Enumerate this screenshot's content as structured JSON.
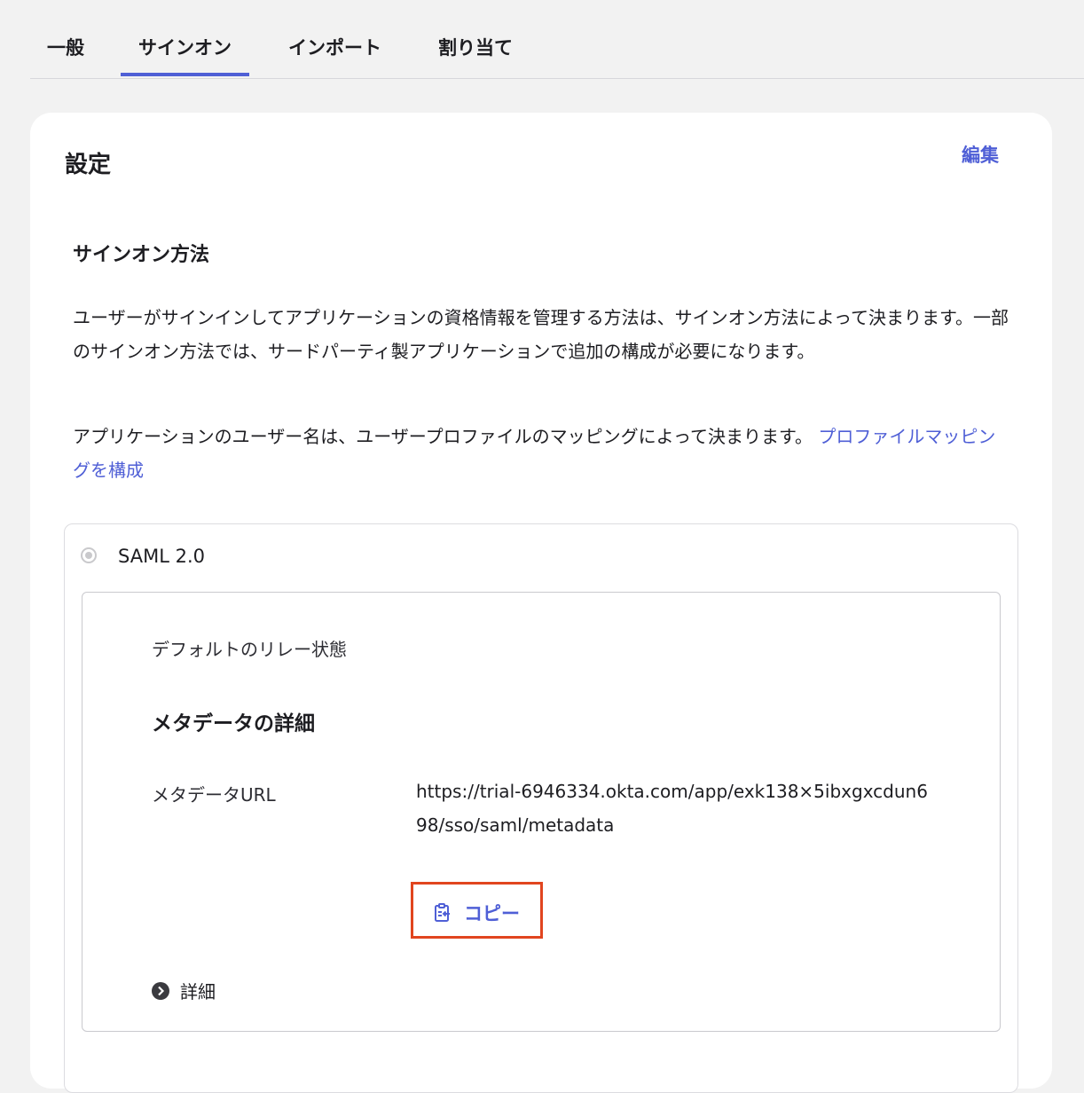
{
  "tabs": [
    {
      "label": "一般",
      "active": false
    },
    {
      "label": "サインオン",
      "active": true
    },
    {
      "label": "インポート",
      "active": false
    },
    {
      "label": "割り当て",
      "active": false
    }
  ],
  "settings": {
    "title": "設定",
    "edit_label": "編集"
  },
  "sign_on_method": {
    "title": "サインオン方法",
    "description": "ユーザーがサインインしてアプリケーションの資格情報を管理する方法は、サインオン方法によって決まります。一部のサインオン方法では、サードパーティ製アプリケーションで追加の構成が必要になります。",
    "username_text": "アプリケーションのユーザー名は、ユーザープロファイルのマッピングによって決まります。",
    "profile_mapping_link": "プロファイルマッピングを構成"
  },
  "saml": {
    "label": "SAML 2.0",
    "relay_state_label": "デフォルトのリレー状態",
    "metadata_title": "メタデータの詳細",
    "metadata_url_label": "メタデータURL",
    "metadata_url": "https://trial-6946334.okta.com/app/exk138×5ibxgxcdun698/sso/saml/metadata",
    "copy_label": "コピー",
    "details_label": "詳細"
  },
  "colors": {
    "accent": "#4f5fd6",
    "highlight": "#e1451f"
  }
}
